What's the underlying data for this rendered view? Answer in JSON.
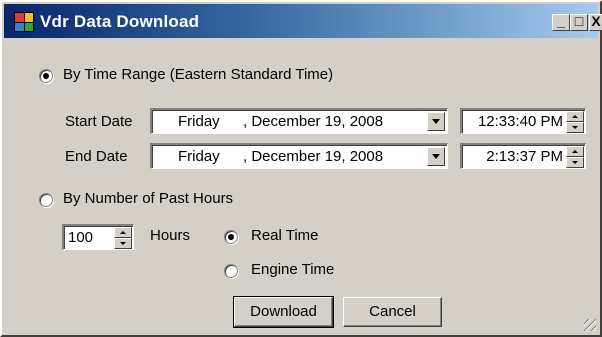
{
  "window": {
    "title": "Vdr Data Download",
    "minimize_glyph": "_",
    "maximize_glyph": "□",
    "close_glyph": "X",
    "icon_colors": [
      "#e23b2f",
      "#f2c219",
      "#2f86d4",
      "#39a33a"
    ]
  },
  "time_range": {
    "label": "By Time Range (Eastern Standard Time)",
    "selected": true,
    "start": {
      "label": "Start Date",
      "day": "Friday",
      "date": ", December 19, 2008",
      "time": "12:33:40 PM"
    },
    "end": {
      "label": "End Date",
      "day": "Friday",
      "date": ", December 19, 2008",
      "time": "2:13:37 PM"
    }
  },
  "past_hours": {
    "label": "By Number of Past Hours",
    "selected": false,
    "hours_value": "100",
    "hours_label": "Hours",
    "real_time_label": "Real Time",
    "real_time_selected": true,
    "engine_time_label": "Engine Time",
    "engine_time_selected": false
  },
  "buttons": {
    "download": "Download",
    "cancel": "Cancel"
  }
}
